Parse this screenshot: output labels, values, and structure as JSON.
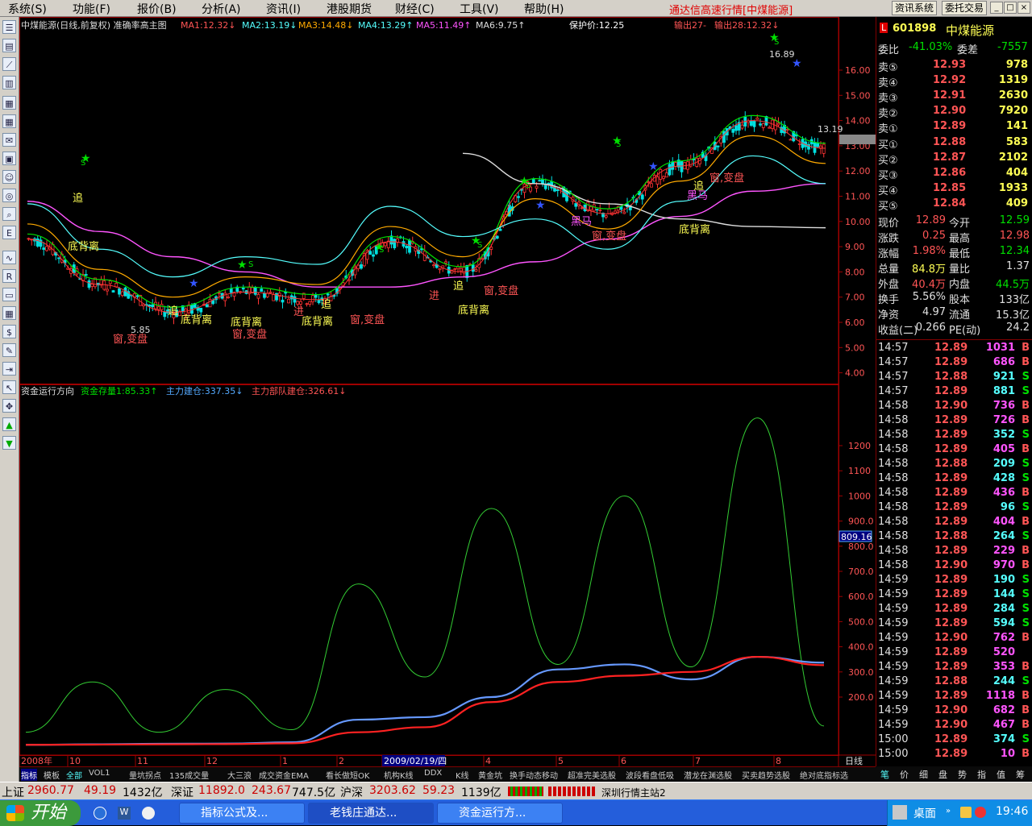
{
  "menu": {
    "items": [
      "系统(S)",
      "功能(F)",
      "报价(B)",
      "分析(A)",
      "资讯(I)",
      "港股期货",
      "财经(C)",
      "工具(V)",
      "帮助(H)"
    ],
    "title": "通达信高速行情[中煤能源]",
    "btn_info": "资讯系统",
    "btn_trade": "委托交易"
  },
  "chart_header": {
    "name": "中煤能源(日线,前复权) 准确率高主图",
    "ma1": "MA1:12.32↓",
    "ma2": "MA2:13.19↓",
    "ma3": "MA3:14.48↓",
    "ma4": "MA4:13.29↑",
    "ma5": "MA5:11.49↑",
    "ma6": "MA6:9.75↑",
    "protect": "保护价:12.25",
    "out27": "输出27-",
    "out28": "输出28:12.32↓"
  },
  "sub_header": {
    "name": "资金运行方向",
    "stock": "资金存量1:85.33↑",
    "main": "主力建仓:337.35↓",
    "army": "主力部队建仓:326.61↓"
  },
  "price_axis": [
    "16.00",
    "15.00",
    "14.00",
    "13.00",
    "12.00",
    "11.00",
    "10.00",
    "9.00",
    "8.00",
    "7.00",
    "6.00",
    "5.00",
    "4.00"
  ],
  "price_axis_values": [
    16,
    15,
    14,
    13,
    12,
    11,
    10,
    9,
    8,
    7,
    6,
    5,
    4
  ],
  "current_price_tag": "13.19",
  "fund_axis": [
    "1200",
    "1100",
    "1000",
    "900.0",
    "800.0",
    "700.0",
    "600.0",
    "500.0",
    "400.0",
    "300.0",
    "200.0"
  ],
  "fund_axis_values": [
    1200,
    1100,
    1000,
    900,
    800,
    700,
    600,
    500,
    400,
    300,
    200
  ],
  "fund_tag": "809.16",
  "date_axis": [
    "2008年",
    "10",
    "11",
    "12",
    "1",
    "2",
    "2009/02/19/四",
    "4",
    "5",
    "6",
    "7",
    "8"
  ],
  "date_axis_type": "日线",
  "annotations": {
    "high": "16.89",
    "low": "5.85",
    "divergence": "底背离",
    "chase": "追",
    "window": "窗,变盘",
    "dark_horse": "黑马",
    "enter": "进",
    "s": "S"
  },
  "chart_data": [
    {
      "type": "line",
      "title": "中煤能源(日线,前复权)",
      "x": [
        "2008-09",
        "2008-10",
        "2008-11",
        "2008-12",
        "2009-01",
        "2009-02",
        "2009-03",
        "2009-04",
        "2009-05",
        "2009-06",
        "2009-07",
        "2009-08"
      ],
      "series": [
        {
          "name": "收盘价",
          "values": [
            9.3,
            7.5,
            6.4,
            7.2,
            6.9,
            9.2,
            8.0,
            11.5,
            10.3,
            12.2,
            14.0,
            12.9
          ]
        },
        {
          "name": "MA5",
          "values": [
            10.8,
            9.6,
            8.6,
            8.0,
            7.4,
            7.4,
            7.8,
            8.4,
            9.3,
            10.2,
            11.2,
            11.5
          ]
        },
        {
          "name": "MA6",
          "values": [
            null,
            null,
            null,
            null,
            null,
            null,
            12.7,
            11.5,
            10.7,
            10.1,
            9.8,
            9.75
          ]
        }
      ],
      "ylim": [
        4,
        17
      ]
    },
    {
      "type": "line",
      "title": "资金运行方向",
      "series": [
        {
          "name": "资金存量1",
          "values": [
            60,
            260,
            60,
            230,
            70,
            650,
            280,
            950,
            330,
            1000,
            320,
            1310,
            85
          ]
        },
        {
          "name": "主力建仓",
          "values": [
            10,
            12,
            14,
            15,
            20,
            110,
            120,
            200,
            310,
            330,
            270,
            360,
            337
          ]
        },
        {
          "name": "主力部队建仓",
          "values": [
            10,
            11,
            12,
            13,
            16,
            60,
            80,
            180,
            260,
            285,
            300,
            360,
            327
          ]
        }
      ],
      "ylim": [
        0,
        1350
      ]
    }
  ],
  "quote": {
    "code": "601898",
    "name": "中煤能源",
    "ratio_label": "委比",
    "ratio": "-41.03%",
    "diff_label": "委差",
    "diff": "-7557",
    "asks": [
      {
        "label": "卖⑤",
        "price": "12.93",
        "vol": "978"
      },
      {
        "label": "卖④",
        "price": "12.92",
        "vol": "1319"
      },
      {
        "label": "卖③",
        "price": "12.91",
        "vol": "2630"
      },
      {
        "label": "卖②",
        "price": "12.90",
        "vol": "7920"
      },
      {
        "label": "卖①",
        "price": "12.89",
        "vol": "141"
      }
    ],
    "bids": [
      {
        "label": "买①",
        "price": "12.88",
        "vol": "583"
      },
      {
        "label": "买②",
        "price": "12.87",
        "vol": "2102"
      },
      {
        "label": "买③",
        "price": "12.86",
        "vol": "404"
      },
      {
        "label": "买④",
        "price": "12.85",
        "vol": "1933"
      },
      {
        "label": "买⑤",
        "price": "12.84",
        "vol": "409"
      }
    ],
    "stats": [
      {
        "l1": "现价",
        "v1": "12.89",
        "l2": "今开",
        "v2": "12.59"
      },
      {
        "l1": "涨跌",
        "v1": "0.25",
        "l2": "最高",
        "v2": "12.98"
      },
      {
        "l1": "涨幅",
        "v1": "1.98%",
        "l2": "最低",
        "v2": "12.34"
      },
      {
        "l1": "总量",
        "v1": "84.8万",
        "l2": "量比",
        "v2": "1.37"
      },
      {
        "l1": "外盘",
        "v1": "40.4万",
        "l2": "内盘",
        "v2": "44.5万"
      },
      {
        "l1": "换手",
        "v1": "5.56%",
        "l2": "股本",
        "v2": "133亿"
      },
      {
        "l1": "净资",
        "v1": "4.97",
        "l2": "流通",
        "v2": "15.3亿"
      },
      {
        "l1": "收益(二)",
        "v1": "0.266",
        "l2": "PE(动)",
        "v2": "24.2"
      }
    ]
  },
  "ticks": [
    {
      "t": "14:57",
      "p": "12.89",
      "v": "1031",
      "d": "B"
    },
    {
      "t": "14:57",
      "p": "12.89",
      "v": "686",
      "d": "B"
    },
    {
      "t": "14:57",
      "p": "12.88",
      "v": "921",
      "d": "S"
    },
    {
      "t": "14:57",
      "p": "12.89",
      "v": "881",
      "d": "S"
    },
    {
      "t": "14:58",
      "p": "12.90",
      "v": "736",
      "d": "B"
    },
    {
      "t": "14:58",
      "p": "12.89",
      "v": "726",
      "d": "B"
    },
    {
      "t": "14:58",
      "p": "12.89",
      "v": "352",
      "d": "S"
    },
    {
      "t": "14:58",
      "p": "12.89",
      "v": "405",
      "d": "B"
    },
    {
      "t": "14:58",
      "p": "12.88",
      "v": "209",
      "d": "S"
    },
    {
      "t": "14:58",
      "p": "12.89",
      "v": "428",
      "d": "S"
    },
    {
      "t": "14:58",
      "p": "12.89",
      "v": "436",
      "d": "B"
    },
    {
      "t": "14:58",
      "p": "12.89",
      "v": "96",
      "d": "S"
    },
    {
      "t": "14:58",
      "p": "12.89",
      "v": "404",
      "d": "B"
    },
    {
      "t": "14:58",
      "p": "12.88",
      "v": "264",
      "d": "S"
    },
    {
      "t": "14:58",
      "p": "12.89",
      "v": "229",
      "d": "B"
    },
    {
      "t": "14:58",
      "p": "12.90",
      "v": "970",
      "d": "B"
    },
    {
      "t": "14:59",
      "p": "12.89",
      "v": "190",
      "d": "S"
    },
    {
      "t": "14:59",
      "p": "12.89",
      "v": "144",
      "d": "S"
    },
    {
      "t": "14:59",
      "p": "12.89",
      "v": "284",
      "d": "S"
    },
    {
      "t": "14:59",
      "p": "12.89",
      "v": "594",
      "d": "S"
    },
    {
      "t": "14:59",
      "p": "12.90",
      "v": "762",
      "d": "B"
    },
    {
      "t": "14:59",
      "p": "12.89",
      "v": "520",
      "d": ""
    },
    {
      "t": "14:59",
      "p": "12.89",
      "v": "353",
      "d": "B"
    },
    {
      "t": "14:59",
      "p": "12.88",
      "v": "244",
      "d": "S"
    },
    {
      "t": "14:59",
      "p": "12.89",
      "v": "1118",
      "d": "B"
    },
    {
      "t": "14:59",
      "p": "12.90",
      "v": "682",
      "d": "B"
    },
    {
      "t": "14:59",
      "p": "12.90",
      "v": "467",
      "d": "B"
    },
    {
      "t": "15:00",
      "p": "12.89",
      "v": "374",
      "d": "S"
    },
    {
      "t": "15:00",
      "p": "12.89",
      "v": "10",
      "d": "B"
    }
  ],
  "bottom_tabs": [
    "指标",
    "模板",
    "全部",
    "VOL1",
    "量坑拐点",
    "135成交量",
    "大三浪",
    "成交资金EMA",
    "看长做短OK",
    "机构K线",
    "DDX",
    "K线",
    "黄金坑",
    "换手动态移动",
    "超准完美选股",
    "波段看盘低吸",
    "潜龙在渊选股",
    "买卖趋势选股",
    "绝对底指标选"
  ],
  "right_tabs": [
    "笔",
    "价",
    "细",
    "盘",
    "势",
    "指",
    "值",
    "筹"
  ],
  "status": {
    "sh_label": "上证",
    "sh_val": "2960.77",
    "sh_chg": "49.19",
    "sh_amt": "1432亿",
    "sz_label": "深证",
    "sz_val": "11892.0",
    "sz_chg": "243.67",
    "sz_amt": "747.5亿",
    "hs_label": "沪深",
    "hs_val": "3203.62",
    "hs_chg": "59.23",
    "hs_amt": "1139亿",
    "server": "深圳行情主站2"
  },
  "taskbar": {
    "start": "开始",
    "tasks": [
      "指标公式及...",
      "老钱庄通达...",
      "资金运行方..."
    ],
    "desktop": "桌面",
    "clock": "19:46"
  }
}
